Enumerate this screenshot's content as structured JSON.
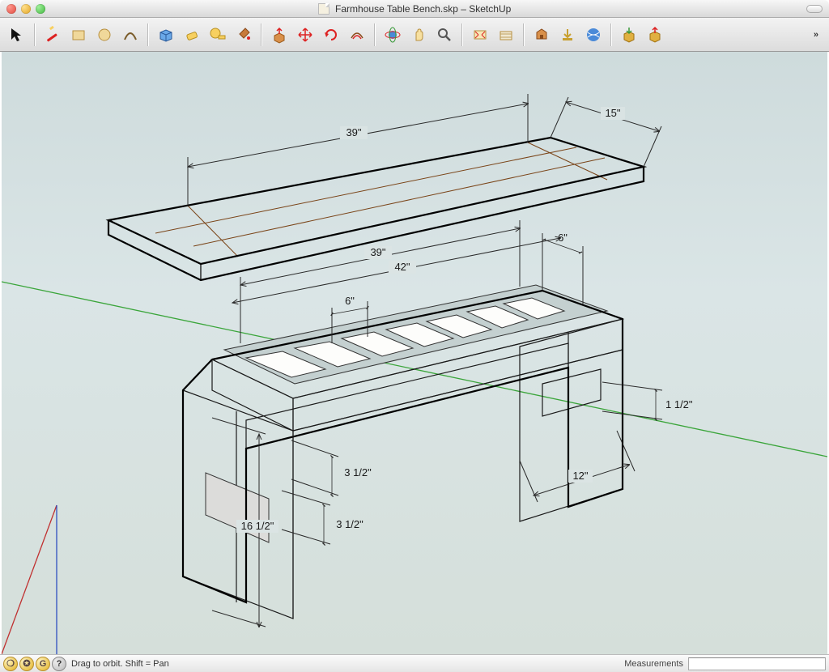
{
  "window": {
    "title": "Farmhouse Table Bench.skp – SketchUp"
  },
  "toolbar": {
    "tools": [
      {
        "name": "select",
        "interact": true
      },
      {
        "name": "line",
        "interact": true
      },
      {
        "name": "rectangle",
        "interact": true
      },
      {
        "name": "circle",
        "interact": true
      },
      {
        "name": "arc",
        "interact": true
      },
      {
        "name": "make-component",
        "interact": true
      },
      {
        "name": "erase",
        "interact": true
      },
      {
        "name": "tape-measure",
        "interact": true
      },
      {
        "name": "paint-bucket",
        "interact": true
      },
      {
        "name": "push-pull",
        "interact": true
      },
      {
        "name": "move",
        "interact": true
      },
      {
        "name": "rotate",
        "interact": true
      },
      {
        "name": "offset",
        "interact": true
      },
      {
        "name": "orbit",
        "interact": true
      },
      {
        "name": "pan",
        "interact": true
      },
      {
        "name": "zoom",
        "interact": true
      },
      {
        "name": "zoom-extents",
        "interact": true
      },
      {
        "name": "add-location",
        "interact": true
      },
      {
        "name": "3d-warehouse-get",
        "interact": true
      },
      {
        "name": "3d-warehouse-share",
        "interact": true
      },
      {
        "name": "google-earth",
        "interact": true
      },
      {
        "name": "extension-1",
        "interact": true
      },
      {
        "name": "extension-2",
        "interact": true
      }
    ]
  },
  "dimensions": {
    "top_length": "39\"",
    "top_width": "15\"",
    "frame_inner": "39\"",
    "frame_outer": "42\"",
    "spacing": "6\"",
    "spacing2": "6\"",
    "leg_width": "12\"",
    "height": "16 1/2\"",
    "apron1": "3 1/2\"",
    "apron2": "3 1/2\"",
    "stretcher": "1 1/2\""
  },
  "status": {
    "hint": "Drag to orbit.  Shift = Pan",
    "measurements_label": "Measurements"
  }
}
